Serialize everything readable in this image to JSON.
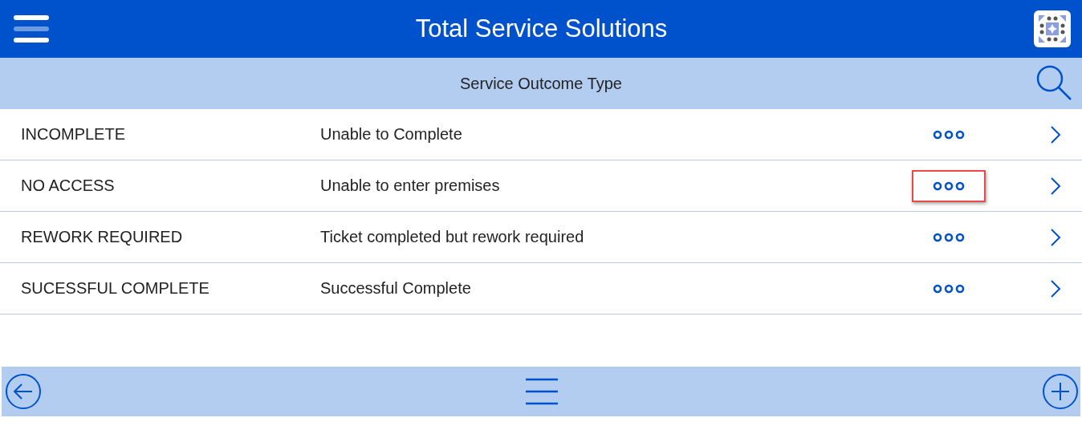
{
  "header": {
    "title": "Total Service Solutions"
  },
  "subheader": {
    "title": "Service Outcome Type"
  },
  "rows": [
    {
      "code": "INCOMPLETE",
      "description": "Unable to Complete",
      "highlighted": false
    },
    {
      "code": "NO ACCESS",
      "description": "Unable to enter premises",
      "highlighted": true
    },
    {
      "code": "REWORK REQUIRED",
      "description": "Ticket completed but rework required",
      "highlighted": false
    },
    {
      "code": "SUCESSFUL COMPLETE",
      "description": "Successful Complete",
      "highlighted": false
    }
  ]
}
